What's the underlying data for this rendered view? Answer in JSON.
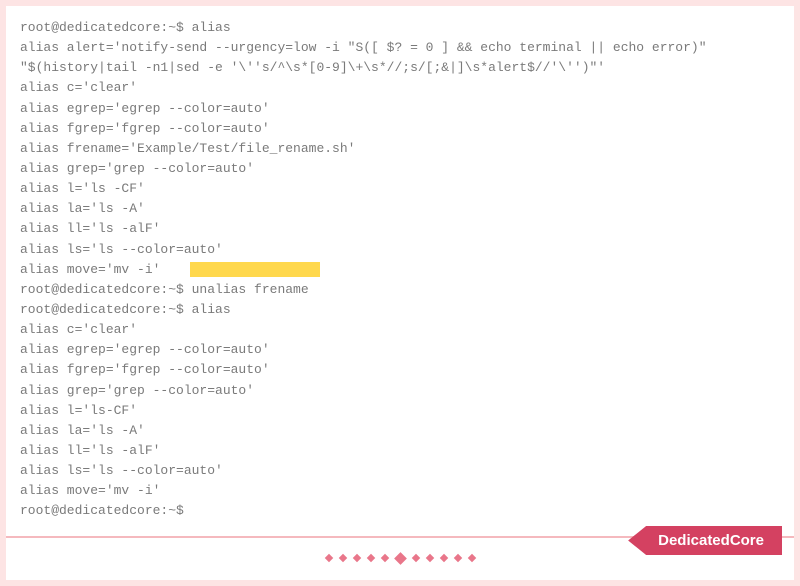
{
  "prompt": "root@dedicatedcore:~$",
  "highlightCmd": "alias move='mv -i'",
  "lines": [
    "root@dedicatedcore:~$ alias",
    "alias alert='notify-send --urgency=low -i \"S([ $? = 0 ] && echo terminal || echo error)\"",
    "\"$(history|tail -n1|sed -e '\\''s/^\\s*[0-9]\\+\\s*//;s/[;&|]\\s*alert$//'\\'')\"'",
    "alias c='clear'",
    "alias egrep='egrep --color=auto'",
    "alias fgrep='fgrep --color=auto'",
    "alias frename='Example/Test/file_rename.sh'",
    "alias grep='grep --color=auto'",
    "alias l='ls -CF'",
    "alias la='ls -A'",
    "alias ll='ls -alF'",
    "alias ls='ls --color=auto'",
    "__HIGHLIGHT__",
    "root@dedicatedcore:~$ unalias frename",
    "root@dedicatedcore:~$ alias",
    "alias c='clear'",
    "alias egrep='egrep --color=auto'",
    "alias fgrep='fgrep --color=auto'",
    "alias grep='grep --color=auto'",
    "alias l='ls-CF'",
    "alias la='ls -A'",
    "alias ll='ls -alF'",
    "alias ls='ls --color=auto'",
    "alias move='mv -i'",
    "root@dedicatedcore:~$"
  ],
  "badge": "DedicatedCore"
}
